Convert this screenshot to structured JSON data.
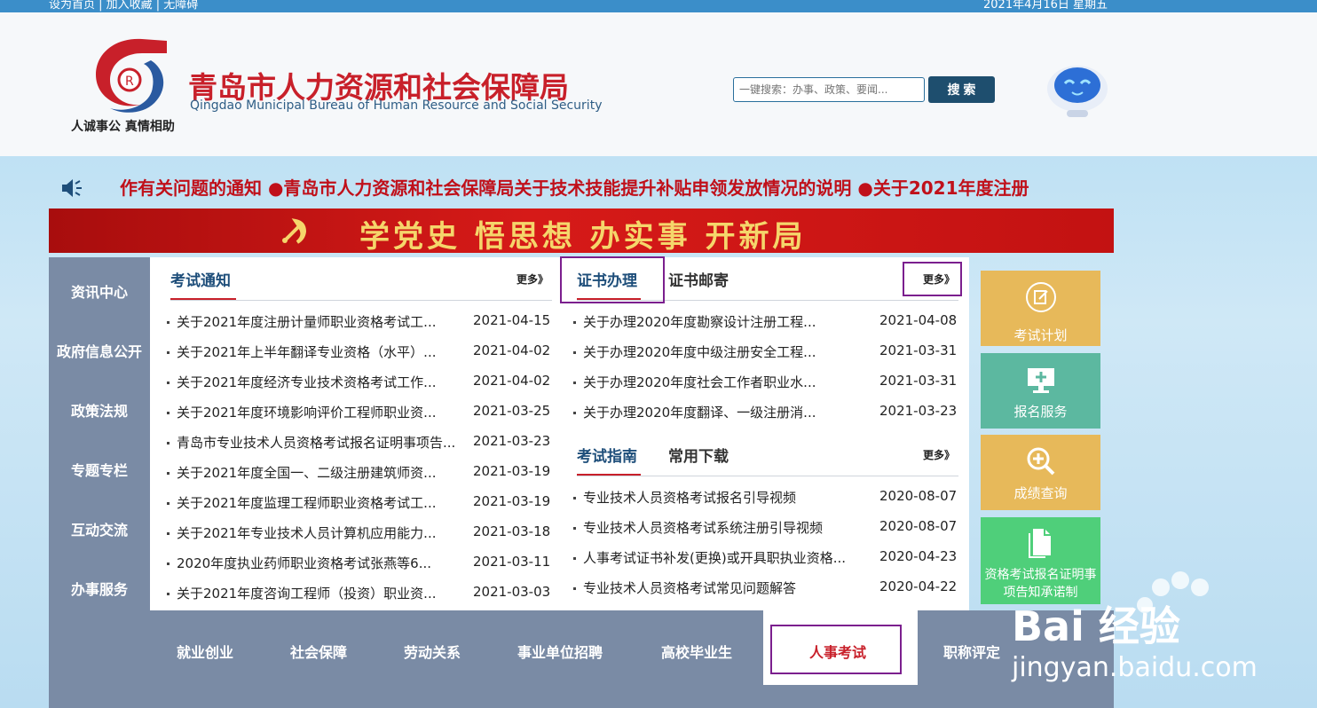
{
  "topbar": {
    "left": "设为首页 | 加入收藏 | 无障碍",
    "right": "2021年4月16日 星期五"
  },
  "header": {
    "title_cn": "青岛市人力资源和社会保障局",
    "title_en": "Qingdao Municipal Bureau of Human Resource and Social Security",
    "slogan": "人诚事公  真情相助",
    "search_placeholder": "一键搜索：办事、政策、要闻...",
    "search_button": "搜 索"
  },
  "marquee": "作有关问题的通知  ●青岛市人力资源和社会保障局关于技术技能提升补贴申领发放情况的说明  ●关于2021年度注册",
  "banner": "学党史  悟思想  办实事  开新局",
  "sidebar": [
    "资讯中心",
    "政府信息公开",
    "政策法规",
    "专题专栏",
    "互动交流",
    "办事服务"
  ],
  "exam_notice": {
    "title": "考试通知",
    "more": "更多》",
    "items": [
      {
        "title": "关于2021年度注册计量师职业资格考试工...",
        "date": "2021-04-15"
      },
      {
        "title": "关于2021年上半年翻译专业资格（水平）...",
        "date": "2021-04-02"
      },
      {
        "title": "关于2021年度经济专业技术资格考试工作...",
        "date": "2021-04-02"
      },
      {
        "title": "关于2021年度环境影响评价工程师职业资...",
        "date": "2021-03-25"
      },
      {
        "title": "青岛市专业技术人员资格考试报名证明事项告...",
        "date": "2021-03-23"
      },
      {
        "title": "关于2021年度全国一、二级注册建筑师资...",
        "date": "2021-03-19"
      },
      {
        "title": "关于2021年度监理工程师职业资格考试工...",
        "date": "2021-03-19"
      },
      {
        "title": "关于2021年专业技术人员计算机应用能力...",
        "date": "2021-03-18"
      },
      {
        "title": "2020年度执业药师职业资格考试张燕等6...",
        "date": "2021-03-11"
      },
      {
        "title": "关于2021年度咨询工程师（投资）职业资...",
        "date": "2021-03-03"
      }
    ]
  },
  "certificate": {
    "tab_active": "证书办理",
    "tab_other": "证书邮寄",
    "more": "更多》",
    "items": [
      {
        "title": "关于办理2020年度勘察设计注册工程...",
        "date": "2021-04-08"
      },
      {
        "title": "关于办理2020年度中级注册安全工程...",
        "date": "2021-03-31"
      },
      {
        "title": "关于办理2020年度社会工作者职业水...",
        "date": "2021-03-31"
      },
      {
        "title": "关于办理2020年度翻译、一级注册消...",
        "date": "2021-03-23"
      }
    ]
  },
  "guide": {
    "tab_active": "考试指南",
    "tab_other": "常用下载",
    "more": "更多》",
    "items": [
      {
        "title": "专业技术人员资格考试报名引导视频",
        "date": "2020-08-07"
      },
      {
        "title": "专业技术人员资格考试系统注册引导视频",
        "date": "2020-08-07"
      },
      {
        "title": "人事考试证书补发(更换)或开具职执业资格...",
        "date": "2020-04-23"
      },
      {
        "title": "专业技术人员资格考试常见问题解答",
        "date": "2020-04-22"
      }
    ]
  },
  "right_buttons": [
    {
      "label": "考试计划",
      "color": "#e7b95a",
      "icon": "edit-icon"
    },
    {
      "label": "报名服务",
      "color": "#5cb8a0",
      "icon": "monitor-icon"
    },
    {
      "label": "成绩查询",
      "color": "#e7b95a",
      "icon": "magnifier-icon"
    },
    {
      "label": "资格考试报名证明事项告知承诺制",
      "color": "#4fcf7a",
      "icon": "document-icon"
    }
  ],
  "nav": [
    "就业创业",
    "社会保障",
    "劳动关系",
    "事业单位招聘",
    "高校毕业生",
    "人事考试",
    "职称评定"
  ],
  "watermark": {
    "brand": "Bai 经验",
    "url": "jingyan.baidu.com"
  }
}
